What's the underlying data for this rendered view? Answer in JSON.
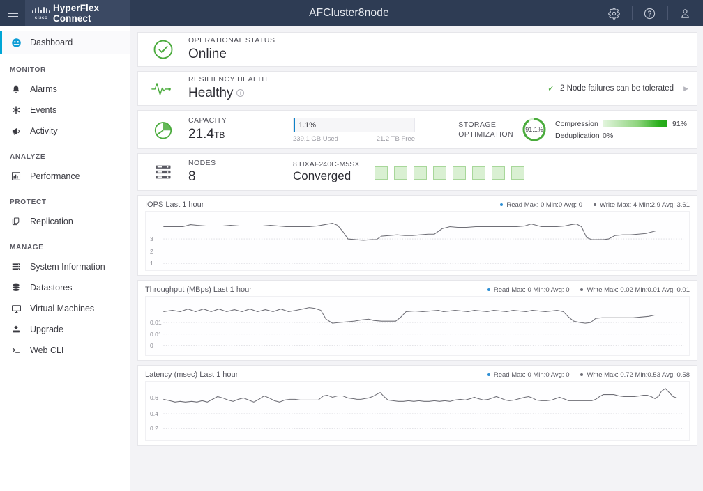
{
  "header": {
    "menu_icon": "hamburger-icon",
    "brand_logo": "cisco-logo",
    "brand_name": "HyperFlex Connect",
    "cluster_title": "AFCluster8node",
    "actions": [
      {
        "name": "settings-button",
        "icon": "gear-icon"
      },
      {
        "name": "help-button",
        "icon": "question-circle-icon"
      },
      {
        "name": "user-button",
        "icon": "user-icon"
      }
    ]
  },
  "sidebar": {
    "dashboard": {
      "label": "Dashboard",
      "icon": "dashboard-icon"
    },
    "sections": [
      {
        "title": "MONITOR",
        "items": [
          {
            "label": "Alarms",
            "icon": "bell-icon"
          },
          {
            "label": "Events",
            "icon": "asterisk-icon"
          },
          {
            "label": "Activity",
            "icon": "megaphone-icon"
          }
        ]
      },
      {
        "title": "ANALYZE",
        "items": [
          {
            "label": "Performance",
            "icon": "bar-chart-icon"
          }
        ]
      },
      {
        "title": "PROTECT",
        "items": [
          {
            "label": "Replication",
            "icon": "copy-icon"
          }
        ]
      },
      {
        "title": "MANAGE",
        "items": [
          {
            "label": "System Information",
            "icon": "server-icon"
          },
          {
            "label": "Datastores",
            "icon": "database-icon"
          },
          {
            "label": "Virtual Machines",
            "icon": "monitor-icon"
          },
          {
            "label": "Upgrade",
            "icon": "upload-icon"
          },
          {
            "label": "Web CLI",
            "icon": "terminal-icon"
          }
        ]
      }
    ]
  },
  "operational_status": {
    "icon": "check-circle-icon",
    "label": "OPERATIONAL STATUS",
    "value": "Online"
  },
  "resiliency_health": {
    "icon": "heartbeat-icon",
    "label": "RESILIENCY HEALTH",
    "value": "Healthy",
    "info_icon": "info-icon",
    "detail_check": "✓",
    "detail": "2 Node failures can be tolerated",
    "expand_icon": "chevron-right-icon"
  },
  "capacity": {
    "icon": "pie-chart-icon",
    "label": "CAPACITY",
    "total": "21.4",
    "total_unit": "TB",
    "used_percent_label": "1.1%",
    "used_percent": 1.1,
    "used": "239.1 GB Used",
    "free": "21.2 TB Free",
    "bar_color": "#0d82c8"
  },
  "storage_optimization": {
    "label_line1": "STORAGE",
    "label_line2": "OPTIMIZATION",
    "donut_value": "91.1%",
    "donut_percent": 91.1,
    "donut_color": "#4aab3c",
    "rows": [
      {
        "name": "Compression",
        "percent_label": "91%",
        "percent": 91
      },
      {
        "name": "Deduplication",
        "percent_label": "0%",
        "percent": 0
      }
    ]
  },
  "nodes": {
    "icon": "nodes-icon",
    "label": "NODES",
    "count": "8",
    "model": "8  HXAF240C-M5SX",
    "type": "Converged",
    "node_count": 8,
    "node_color": "#d9f0d2"
  },
  "charts": [
    {
      "title": "IOPS Last 1 hour",
      "legend": [
        {
          "label": "Read Max: 0 Min:0 Avg: 0",
          "color": "#2e8fd4"
        },
        {
          "label": "Write Max: 4 Min:2.9 Avg: 3.61",
          "color": "#6e6e76"
        }
      ],
      "yticks": [
        "3",
        "2",
        "1"
      ],
      "ytick_positions": [
        40,
        58,
        76
      ],
      "line": "0,22 18,22 30,22 42,19 52,20 66,21 80,21 92,21 104,20 118,21 130,21 142,21 154,21 166,20 178,21 190,22 202,22 214,22 226,22 238,21 250,19 262,17 270,20 278,29 286,40 298,41 310,42 322,41 330,41 338,36 350,35 362,34 374,35 386,35 398,34 410,33 420,33 432,25 444,22 456,23 470,23 484,22 498,22 512,22 524,22 536,22 548,22 560,21 570,18 578,20 586,22 598,22 610,22 622,21 632,19 640,18 648,22 656,38 664,41 672,41 682,41 690,40 700,35 712,34 724,34 736,33 748,32 756,30 764,28"
    },
    {
      "title": "Throughput (MBps) Last 1 hour",
      "legend": [
        {
          "label": "Read Max: 0 Min:0 Avg: 0",
          "color": "#2e8fd4"
        },
        {
          "label": "Write Max: 0.02 Min:0.01 Avg: 0.01",
          "color": "#6e6e76"
        }
      ],
      "yticks": [
        "0.01",
        "0.01",
        "0"
      ],
      "ytick_positions": [
        38,
        55,
        72
      ],
      "line": "0,22 14,20 26,22 38,18 50,22 62,18 74,22 86,18 98,22 110,19 122,22 134,18 146,22 158,19 170,22 182,18 194,22 206,20 216,18 226,16 234,17 244,20 252,33 262,39 272,38 284,37 296,36 308,34 318,33 326,35 338,36 348,36 360,36 368,30 376,22 390,21 402,22 414,21 426,20 434,22 444,21 452,20 462,21 472,22 482,20 492,21 502,22 512,20 522,21 532,22 542,20 552,21 562,22 572,20 582,21 592,22 602,21 610,20 620,22 628,30 636,36 646,38 654,39 662,38 670,32 680,31 692,31 704,31 716,31 728,31 740,30 752,29 762,27"
    },
    {
      "title": "Latency (msec) Last 1 hour",
      "legend": [
        {
          "label": "Read Max: 0 Min:0 Avg: 0",
          "color": "#2e8fd4"
        },
        {
          "label": "Write Max: 0.72 Min:0.53 Avg: 0.58",
          "color": "#6e6e76"
        }
      ],
      "yticks": [
        "0.6",
        "0.4",
        "0.2"
      ],
      "ytick_positions": [
        24,
        47,
        69
      ],
      "line": "0,26 10,28 18,30 26,29 34,30 44,29 52,30 60,28 68,30 76,26 84,22 92,24 100,27 108,29 116,26 124,24 132,27 140,30 148,26 156,21 164,24 172,28 180,30 188,27 196,26 204,26 212,27 216,27 224,27 232,27 240,27 248,21 254,20 262,23 270,21 278,21 286,24 294,25 300,26 306,26 312,25 318,24 324,22 330,19 336,16 342,22 348,27 356,28 364,29 372,29 380,28 388,29 396,28 404,29 412,29 420,28 428,29 436,28 444,29 452,27 460,26 468,27 476,25 482,23 488,25 496,27 504,26 510,24 516,22 522,24 530,27 536,28 544,27 552,25 560,23 566,22 572,24 578,27 586,28 594,28 602,27 608,25 614,23 620,25 628,28 636,28 644,28 650,28 656,28 664,28 670,26 676,22 682,19 690,19 698,19 706,21 714,22 722,22 730,22 738,21 744,20 750,20 756,22 762,25 768,21 772,14 778,10 784,16 790,22 796,24"
    }
  ]
}
